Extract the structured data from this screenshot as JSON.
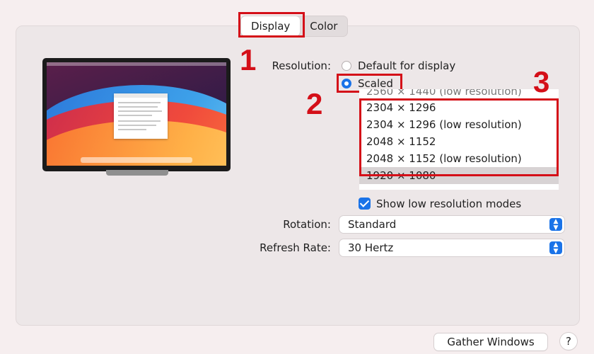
{
  "tabs": [
    {
      "label": "Display",
      "active": true
    },
    {
      "label": "Color",
      "active": false
    }
  ],
  "annotations": {
    "step1": "1",
    "step2": "2",
    "step3": "3",
    "color": "#d40f18"
  },
  "resolution": {
    "label": "Resolution:",
    "options": [
      {
        "label": "Default for display",
        "selected": false
      },
      {
        "label": "Scaled",
        "selected": true
      }
    ],
    "list": [
      "2560 × 1440 (low resolution)",
      "2304 × 1296",
      "2304 × 1296 (low resolution)",
      "2048 × 1152",
      "2048 × 1152 (low resolution)",
      "1920 × 1080"
    ],
    "show_low_res": {
      "label": "Show low resolution modes",
      "checked": true
    }
  },
  "rotation": {
    "label": "Rotation:",
    "value": "Standard"
  },
  "refresh_rate": {
    "label": "Refresh Rate:",
    "value": "30 Hertz"
  },
  "footer": {
    "gather_windows": "Gather Windows",
    "help": "?"
  },
  "accent_color": "#1a73e8"
}
